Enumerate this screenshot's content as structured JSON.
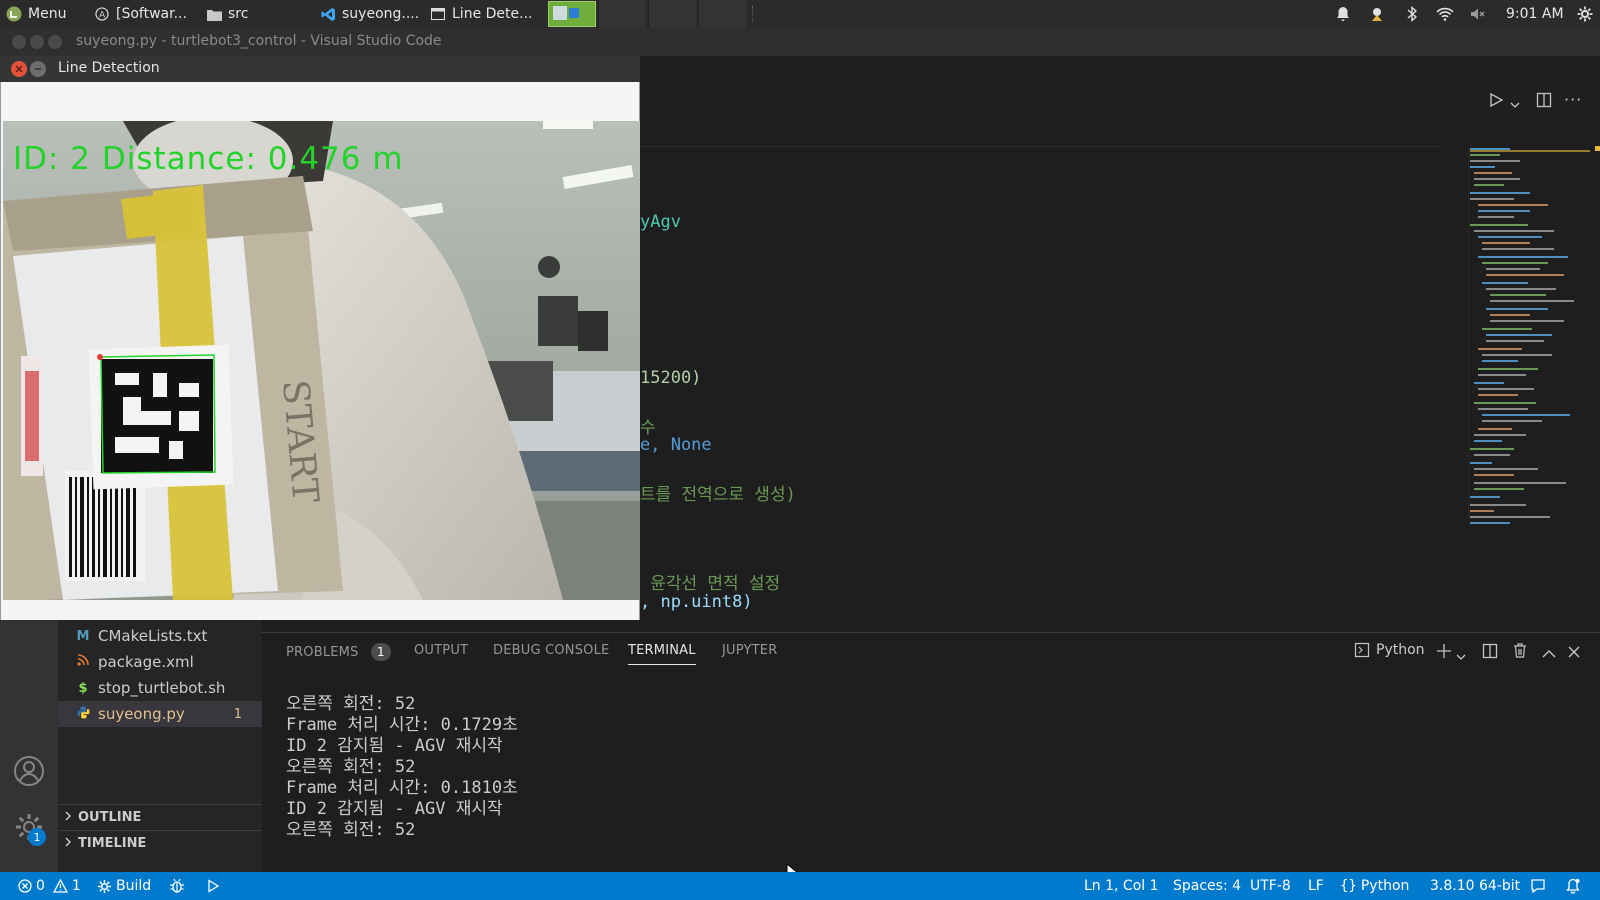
{
  "topbar": {
    "menu_label": "Menu",
    "tasks": [
      {
        "label": "[Softwar..."
      },
      {
        "label": "src"
      },
      {
        "label": "suyeong...."
      },
      {
        "label": "Line Dete..."
      }
    ],
    "clock": "9:01 AM"
  },
  "vscode": {
    "window_title": "suyeong.py - turtlebot3_control - Visual Studio Code",
    "code_fragments": [
      {
        "text": "yAgv",
        "color": "#4ec9b0"
      },
      {
        "text": "15200)",
        "color": "#d4d4d4",
        "accent": "#b5cea8"
      },
      {
        "text": "수",
        "color": "#6a9955"
      },
      {
        "text": "e, None",
        "color": "#d4d4d4",
        "accent": "#569cd6"
      },
      {
        "text": "트를 전역으로 생성)",
        "color": "#6a9955"
      },
      {
        "text": " 윤각선 면적 설정",
        "color": "#6a9955"
      },
      {
        "text": ", np.uint8)",
        "color": "#d4d4d4",
        "accent": "#4ec9b0"
      }
    ]
  },
  "line_detection": {
    "title": "Line Detection",
    "overlay_text": "ID: 2 Distance: 0.476 m"
  },
  "explorer": {
    "files": [
      {
        "name": "CMakeLists.txt",
        "icon": "M",
        "icon_color": "#519aba",
        "badge": ""
      },
      {
        "name": "package.xml",
        "icon": "rss",
        "icon_color": "#e37933",
        "badge": ""
      },
      {
        "name": "stop_turtlebot.sh",
        "icon": "$",
        "icon_color": "#89e051",
        "badge": ""
      },
      {
        "name": "suyeong.py",
        "icon": "python",
        "icon_color": "#3572a5",
        "badge": "1"
      }
    ],
    "sections": {
      "outline": "OUTLINE",
      "timeline": "TIMELINE"
    },
    "settings_badge": "1"
  },
  "panel": {
    "tabs": {
      "problems": "PROBLEMS",
      "problems_count": "1",
      "output": "OUTPUT",
      "debug": "DEBUG CONSOLE",
      "terminal": "TERMINAL",
      "jupyter": "JUPYTER"
    },
    "terminal_profile": "Python",
    "terminal_lines": [
      "오른쪽 회전: 52",
      "Frame 처리 시간: 0.1729초",
      "ID 2 감지됨 - AGV 재시작",
      "오른쪽 회전: 52",
      "Frame 처리 시간: 0.1810초",
      "ID 2 감지됨 - AGV 재시작",
      "오른쪽 회전: 52"
    ]
  },
  "statusbar": {
    "errors": "0",
    "warnings": "1",
    "build": "Build",
    "position": "Ln 1, Col 1",
    "spaces": "Spaces: 4",
    "encoding": "UTF-8",
    "eol": "LF",
    "language": "Python",
    "interpreter": "3.8.10 64-bit"
  },
  "colors": {
    "accent": "#007acc",
    "overlay_green": "#22d32a"
  }
}
